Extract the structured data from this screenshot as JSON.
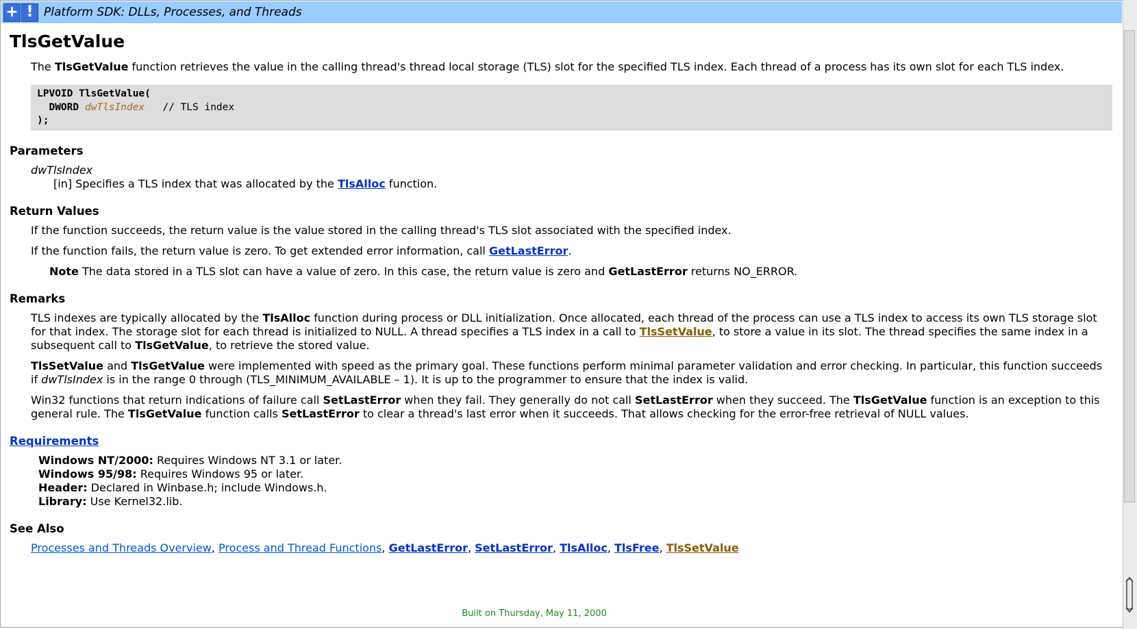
{
  "topbar": {
    "expand_glyph": "+",
    "info_glyph": "!",
    "title": "Platform SDK: DLLs, Processes, and Threads"
  },
  "page": {
    "heading": "TlsGetValue",
    "intro": {
      "pre": "The ",
      "bold": "TlsGetValue",
      "post": " function retrieves the value in the calling thread's thread local storage (TLS) slot for the specified TLS index. Each thread of a process has its own slot for each TLS index."
    },
    "syntax": {
      "line1_type": "LPVOID",
      "line1_fn": " TlsGetValue(",
      "line2_type": "DWORD",
      "line2_param": "dwTlsIndex",
      "line2_comment": "   // TLS index",
      "line3": ");"
    },
    "parameters": {
      "heading": "Parameters",
      "term": "dwTlsIndex",
      "desc_pre": "[in] Specifies a TLS index that was allocated by the ",
      "desc_link": "TlsAlloc",
      "desc_post": " function."
    },
    "return_values": {
      "heading": "Return Values",
      "p1": "If the function succeeds, the return value is the value stored in the calling thread's TLS slot associated with the specified index.",
      "p2_pre": "If the function fails, the return value is zero. To get extended error information, call ",
      "p2_link": "GetLastError",
      "p2_post": ".",
      "note_label": "Note",
      "note_pre": "  The data stored in a TLS slot can have a value of zero. In this case, the return value is zero and ",
      "note_bold": "GetLastError",
      "note_post": " returns NO_ERROR."
    },
    "remarks": {
      "heading": "Remarks",
      "p1_a": "TLS indexes are typically allocated by the ",
      "p1_b": "TlsAlloc",
      "p1_c": " function during process or DLL initialization. Once allocated, each thread of the process can use a TLS index to access its own TLS storage slot for that index. The storage slot for each thread is initialized to NULL. A thread specifies a TLS index in a call to ",
      "p1_link": "TlsSetValue",
      "p1_d": ", to store a value in its slot. The thread specifies the same index in a subsequent call to ",
      "p1_e": "TlsGetValue",
      "p1_f": ", to retrieve the stored value.",
      "p2_a": "TlsSetValue",
      "p2_b": " and ",
      "p2_c": "TlsGetValue",
      "p2_d": " were implemented with speed as the primary goal. These functions perform minimal parameter validation and error checking. In particular, this function succeeds if ",
      "p2_e": "dwTlsIndex",
      "p2_f": " is in the range 0 through (TLS_MINIMUM_AVAILABLE – 1). It is up to the programmer to ensure that the index is valid.",
      "p3_a": "Win32 functions that return indications of failure call ",
      "p3_b": "SetLastError",
      "p3_c": " when they fail. They generally do not call ",
      "p3_d": "SetLastError",
      "p3_e": " when they succeed. The ",
      "p3_f": "TlsGetValue",
      "p3_g": " function is an exception to this general rule. The ",
      "p3_h": "TlsGetValue",
      "p3_i": " function calls ",
      "p3_j": "SetLastError",
      "p3_k": " to clear a thread's last error when it succeeds. That allows checking for the error-free retrieval of NULL values."
    },
    "requirements": {
      "heading": "Requirements",
      "rows": [
        {
          "label": "Windows NT/2000:",
          "value": " Requires Windows NT 3.1 or later."
        },
        {
          "label": "Windows 95/98:",
          "value": " Requires Windows 95 or later."
        },
        {
          "label": "Header:",
          "value": " Declared in Winbase.h; include Windows.h."
        },
        {
          "label": "Library:",
          "value": " Use Kernel32.lib."
        }
      ]
    },
    "see_also": {
      "heading": "See Also",
      "links": [
        "Processes and Threads Overview",
        "Process and Thread Functions",
        "GetLastError",
        "SetLastError",
        "TlsAlloc",
        "TlsFree",
        "TlsSetValue"
      ],
      "separator": ", "
    },
    "footer": "Built on Thursday, May 11, 2000"
  },
  "colors": {
    "topbar_bg": "#99ccff",
    "link": "#0033cc",
    "visited_link": "#8a5d00",
    "code_bg": "#dddddd",
    "footer_text": "#228822"
  },
  "icons": [
    "expand-icon",
    "info-icon",
    "scroll-up-icon"
  ]
}
